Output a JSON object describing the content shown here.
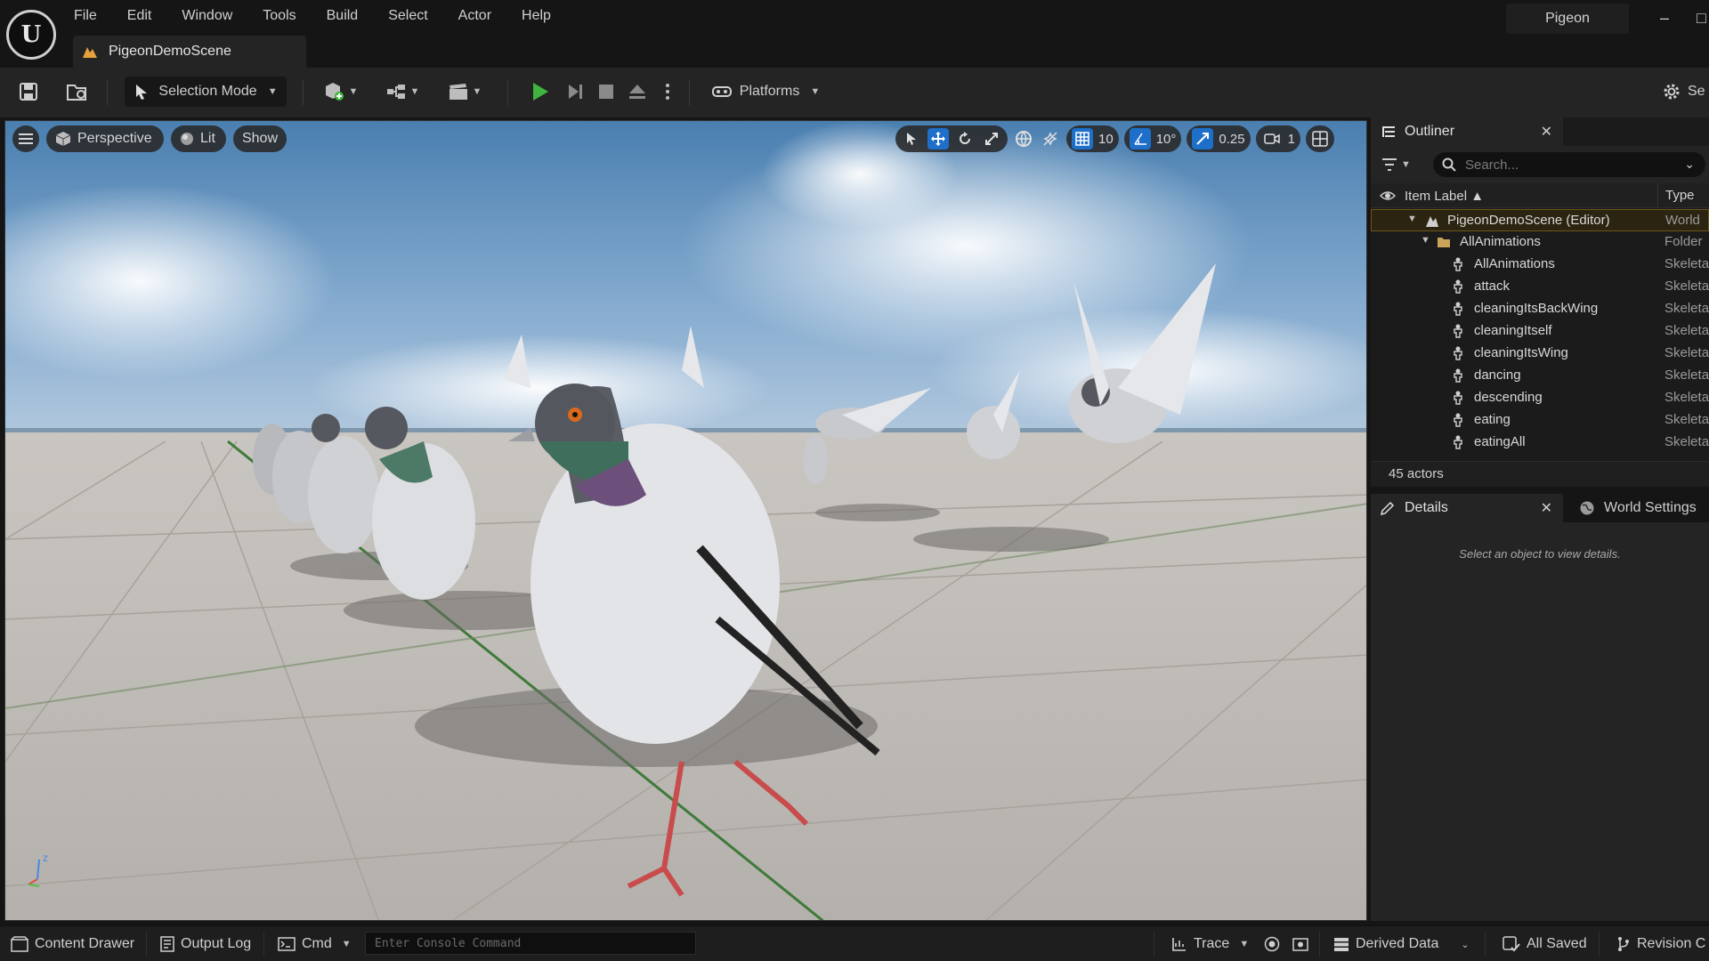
{
  "menu": [
    "File",
    "Edit",
    "Window",
    "Tools",
    "Build",
    "Select",
    "Actor",
    "Help"
  ],
  "document_tab": "PigeonDemoScene",
  "project_name": "Pigeon",
  "toolbar": {
    "selection_mode": "Selection Mode",
    "platforms": "Platforms",
    "settings": "Se"
  },
  "viewport": {
    "perspective": "Perspective",
    "lit": "Lit",
    "show": "Show",
    "grid_snap": "10",
    "rotation_snap": "10°",
    "scale_snap": "0.25",
    "camera_speed": "1",
    "axis_z": "z"
  },
  "outliner": {
    "tab": "Outliner",
    "search_placeholder": "Search...",
    "col_label": "Item Label ▲",
    "col_type": "Type",
    "rows": [
      {
        "label": "PigeonDemoScene (Editor)",
        "type": "World"
      },
      {
        "label": "AllAnimations",
        "type": "Folder"
      },
      {
        "label": "AllAnimations",
        "type": "Skeleta"
      },
      {
        "label": "attack",
        "type": "Skeleta"
      },
      {
        "label": "cleaningItsBackWing",
        "type": "Skeleta"
      },
      {
        "label": "cleaningItself",
        "type": "Skeleta"
      },
      {
        "label": "cleaningItsWing",
        "type": "Skeleta"
      },
      {
        "label": "dancing",
        "type": "Skeleta"
      },
      {
        "label": "descending",
        "type": "Skeleta"
      },
      {
        "label": "eating",
        "type": "Skeleta"
      },
      {
        "label": "eatingAll",
        "type": "Skeleta"
      }
    ],
    "actor_count": "45 actors"
  },
  "details": {
    "tab": "Details",
    "world_settings_tab": "World Settings",
    "empty_message": "Select an object to view details."
  },
  "statusbar": {
    "content_drawer": "Content Drawer",
    "output_log": "Output Log",
    "cmd": "Cmd",
    "console_placeholder": "Enter Console Command",
    "trace": "Trace",
    "derived_data": "Derived Data",
    "all_saved": "All Saved",
    "revision_control": "Revision C"
  },
  "colors": {
    "accent_blue": "#1e6fc9",
    "play_green": "#3fb43f",
    "selection_gold": "#6d5619",
    "panel_bg": "#242424"
  }
}
